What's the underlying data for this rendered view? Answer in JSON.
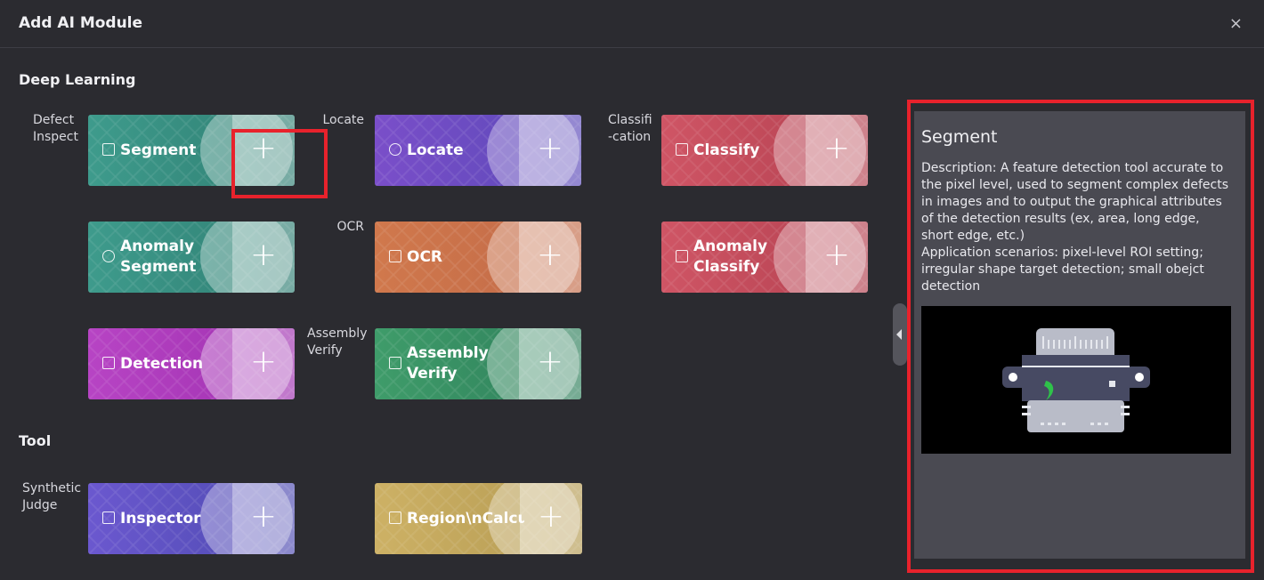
{
  "dialog": {
    "title": "Add AI Module",
    "close_glyph": "×"
  },
  "sections": {
    "deep_learning": "Deep Learning",
    "tool": "Tool"
  },
  "categories": {
    "defect_inspect": "Defect\nInspect",
    "locate": "Locate",
    "classification": "Classifi\n-cation",
    "ocr": "OCR",
    "assembly_verify": "Assembly\nVerify",
    "synthetic_judge": "Synthetic\nJudge"
  },
  "cards": {
    "segment": {
      "label": "Segment",
      "icon": "segment-icon",
      "colors": [
        "#3e9b8c",
        "#2f7e72"
      ]
    },
    "locate": {
      "label": "Locate",
      "icon": "locate-icon",
      "colors": [
        "#7a4ec9",
        "#5a49b8"
      ]
    },
    "classify": {
      "label": "Classify",
      "icon": "classify-icon",
      "colors": [
        "#cf5565",
        "#b3404f"
      ]
    },
    "anomaly_segment": {
      "label": "Anomaly\nSegment",
      "icon": "anomaly-segment-icon",
      "colors": [
        "#3e9b8c",
        "#2f7e72"
      ]
    },
    "ocr": {
      "label": "OCR",
      "icon": "ocr-icon",
      "colors": [
        "#d0784c",
        "#c26a48"
      ]
    },
    "anomaly_classify": {
      "label": "Anomaly\nClassify",
      "icon": "anomaly-classify-icon",
      "colors": [
        "#cf5565",
        "#b3404f"
      ]
    },
    "detection": {
      "label": "Detection",
      "icon": "detection-icon",
      "colors": [
        "#b744c4",
        "#9f30b0"
      ]
    },
    "assembly_verify": {
      "label": "Assembly\nVerify",
      "icon": "assembly-verify-icon",
      "colors": [
        "#3f9c6a",
        "#2d7e5a"
      ]
    },
    "inspector": {
      "label": "Inspector",
      "icon": "inspector-icon",
      "colors": [
        "#6b58cf",
        "#4d4ab0"
      ]
    },
    "region_calc": {
      "label": "Region\\nCalcu",
      "icon": "region-calc-icon",
      "colors": [
        "#cdb165",
        "#b49a52"
      ]
    }
  },
  "plus_glyph": "+",
  "detail": {
    "title": "Segment",
    "description": "Description: A feature detection tool accurate to the pixel level, used to segment complex defects in images and to output the graphical attributes of the detection results (ex, area, long edge, short edge, etc.)\nApplication scenarios: pixel-level ROI setting; irregular shape target detection; small obejct detection"
  },
  "highlight_color": "#e8222c"
}
